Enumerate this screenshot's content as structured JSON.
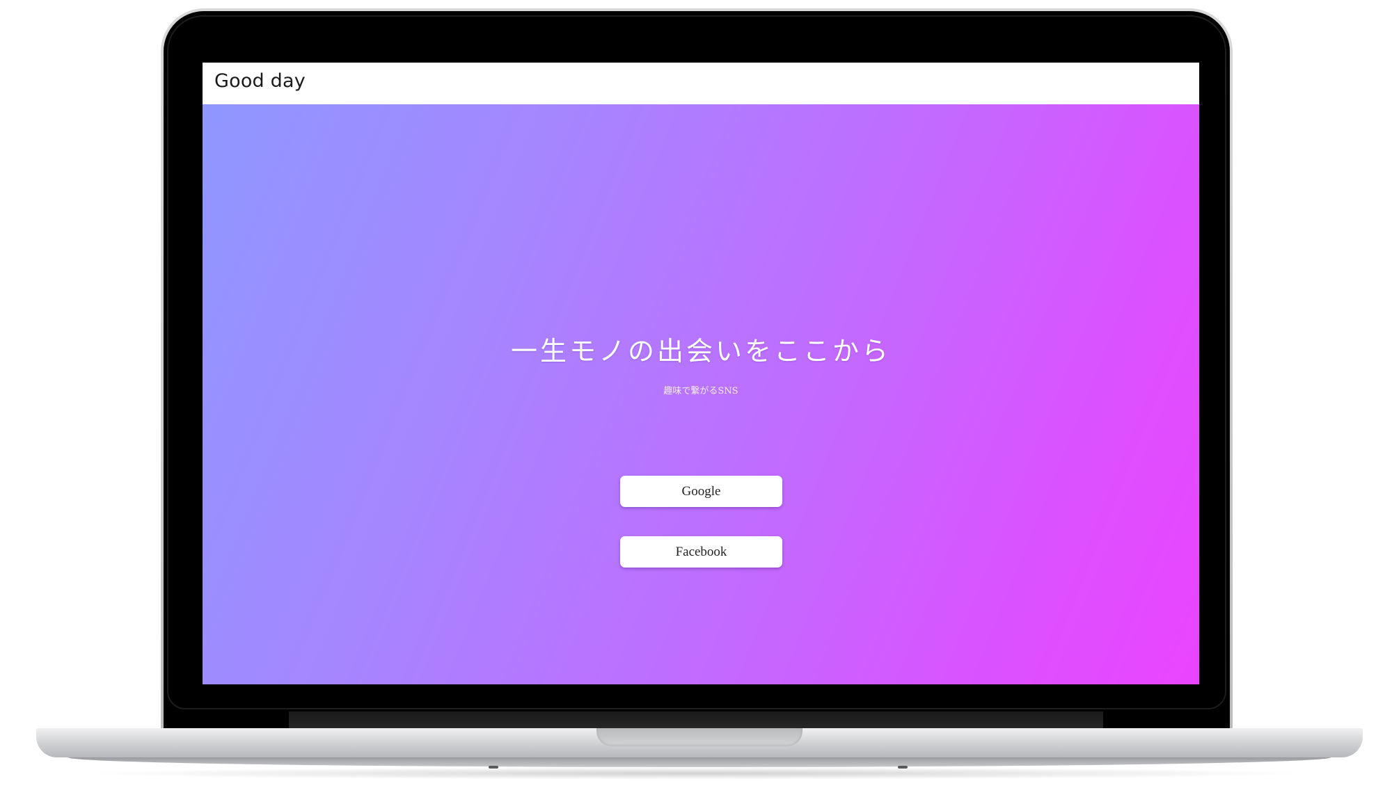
{
  "header": {
    "brand": "Good day"
  },
  "hero": {
    "headline": "一生モノの出会いをここから",
    "subline": "趣味で繋がるSNS"
  },
  "buttons": {
    "google_label": "Google",
    "facebook_label": "Facebook"
  },
  "colors": {
    "gradient_start": "#8f97ff",
    "gradient_end": "#ea44ff",
    "button_bg": "#ffffff",
    "header_bg": "#ffffff"
  }
}
